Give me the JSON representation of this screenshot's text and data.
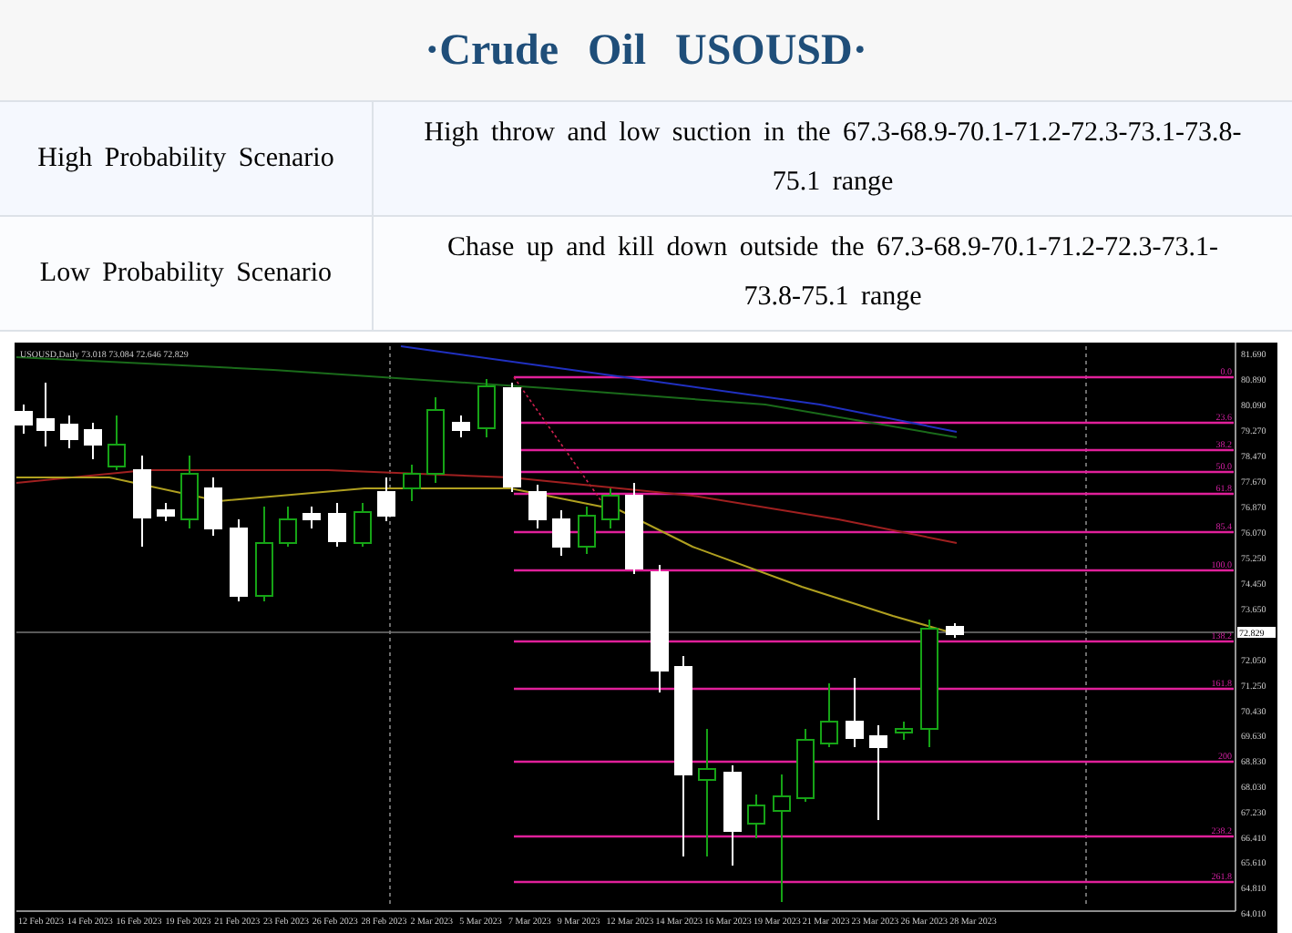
{
  "title": "·Crude Oil USOUSD·",
  "scenarios": [
    {
      "label": "High Probability Scenario",
      "description": "High throw and low suction in the 67.3-68.9-70.1-71.2-72.3-73.1-73.8-75.1 range"
    },
    {
      "label": "Low Probability Scenario",
      "description": "Chase up and kill down outside the 67.3-68.9-70.1-71.2-72.3-73.1-73.8-75.1 range"
    }
  ],
  "chart": {
    "header": "USOUSD,Daily 73.018 73.084 72.646 72.829",
    "price_labels": [
      "81.690",
      "80.890",
      "80.090",
      "79.270",
      "78.470",
      "77.670",
      "76.870",
      "76.070",
      "75.250",
      "74.450",
      "73.650",
      "72.050",
      "71.250",
      "70.430",
      "69.630",
      "68.830",
      "68.030",
      "67.230",
      "66.410",
      "65.610",
      "64.810",
      "64.010"
    ],
    "current_price": "72.829",
    "fib_labels": [
      "0.0",
      "23.6",
      "38.2",
      "50.0",
      "61.8",
      "85.4",
      "100.0",
      "138.2",
      "161.8",
      "200",
      "238.2",
      "261.8"
    ],
    "date_labels": [
      "12 Feb 2023",
      "14 Feb 2023",
      "16 Feb 2023",
      "19 Feb 2023",
      "21 Feb 2023",
      "23 Feb 2023",
      "26 Feb 2023",
      "28 Feb 2023",
      "2 Mar 2023",
      "5 Mar 2023",
      "7 Mar 2023",
      "9 Mar 2023",
      "12 Mar 2023",
      "14 Mar 2023",
      "16 Mar 2023",
      "19 Mar 2023",
      "21 Mar 2023",
      "23 Mar 2023",
      "26 Mar 2023",
      "28 Mar 2023"
    ]
  }
}
